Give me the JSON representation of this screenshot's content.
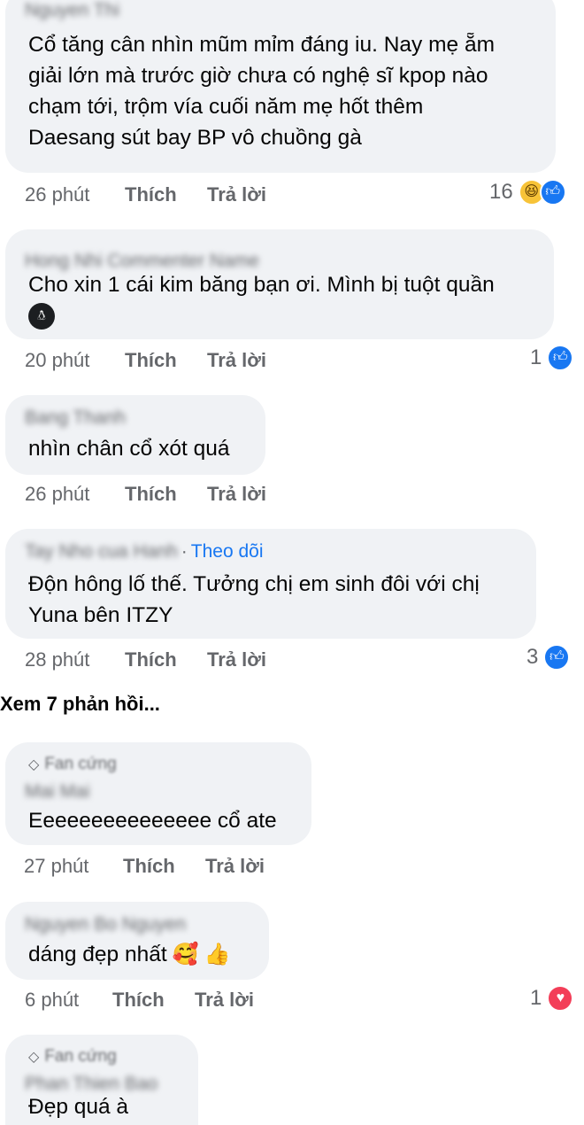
{
  "comments": [
    {
      "author": "Nguyen Thi",
      "lines": [
        "Cổ tăng cân nhìn mũm mỉm đáng iu. Nay mẹ ẵm",
        "giải lớn mà trước giờ chưa có nghệ sĩ kpop nào",
        "chạm tới, trộm vía cuối năm mẹ hốt thêm",
        "Daesang sút bay BP vô chuồng gà"
      ],
      "time": "26 phút",
      "like_label": "Thích",
      "reply_label": "Trả lời",
      "reaction_count": "16",
      "reactions": [
        "haha-icon",
        "like-icon"
      ]
    },
    {
      "author": "Hong Nhi Commenter Name",
      "lines": [
        "Cho xin 1 cái kim băng bạn ơi. Mình bị tuột quần"
      ],
      "emoji": "penguin-emoji",
      "time": "20 phút",
      "like_label": "Thích",
      "reply_label": "Trả lời",
      "reaction_count": "1",
      "reactions": [
        "like-icon"
      ]
    },
    {
      "author": "Bang Thanh",
      "lines": [
        "nhìn chân cổ xót quá"
      ],
      "time": "26 phút",
      "like_label": "Thích",
      "reply_label": "Trả lời"
    },
    {
      "author": "Tay Nho cua Hanh",
      "follow_label": "Theo dõi",
      "lines": [
        "Độn hông lố thế. Tưởng chị em sinh đôi với chị",
        "Yuna bên ITZY"
      ],
      "time": "28 phút",
      "like_label": "Thích",
      "reply_label": "Trả lời",
      "reaction_count": "3",
      "reactions": [
        "like-icon"
      ]
    }
  ],
  "view_replies_label": "Xem 7 phản hồi...",
  "replies": [
    {
      "badge": "Fan cứng",
      "badge_icon": "diamond-icon",
      "author": "Mai Mai",
      "lines": [
        "Eeeeeeeeeeeeeee cổ ate"
      ],
      "time": "27 phút",
      "like_label": "Thích",
      "reply_label": "Trả lời"
    },
    {
      "author": "Nguyen Bo Nguyen",
      "lines": [
        "dáng đẹp nhất"
      ],
      "emojis": [
        "smiling-hearts-emoji",
        "thumbs-up-emoji"
      ],
      "time": "6 phút",
      "like_label": "Thích",
      "reply_label": "Trả lời",
      "reaction_count": "1",
      "reactions": [
        "love-icon"
      ]
    },
    {
      "badge": "Fan cứng",
      "badge_icon": "diamond-icon",
      "author": "Phan Thien Bao",
      "lines": [
        "Đẹp quá à"
      ]
    }
  ],
  "colors": {
    "bubble": "#f0f2f5",
    "meta_text": "#65676b",
    "body_text": "#050505",
    "follow": "#1877f2",
    "like_reaction": "#1877f2",
    "love_reaction": "#f33e58",
    "haha_reaction": "#f7c338"
  }
}
